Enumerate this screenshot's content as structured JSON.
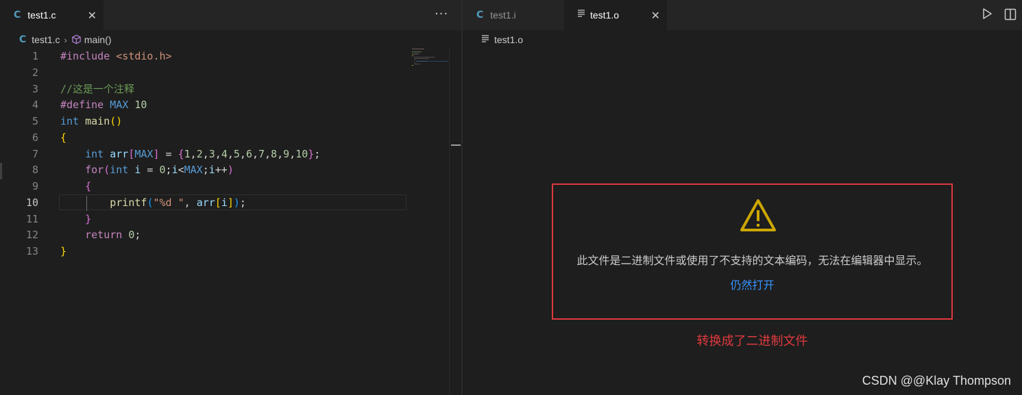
{
  "left": {
    "tab": {
      "icon": "C",
      "label": "test1.c",
      "close": "✕"
    },
    "more_button": "···",
    "breadcrumb": {
      "file_icon": "C",
      "file": "test1.c",
      "sep": "›",
      "symbol": "main()"
    },
    "line_numbers": [
      "1",
      "2",
      "3",
      "4",
      "5",
      "6",
      "7",
      "8",
      "9",
      "10",
      "11",
      "12",
      "13"
    ],
    "current_line": "10"
  },
  "right": {
    "tabs": [
      {
        "icon": "C",
        "label": "test1.i"
      },
      {
        "icon": "file-lines-icon",
        "label": "test1.o",
        "close": "✕"
      }
    ],
    "breadcrumb": {
      "file": "test1.o"
    },
    "warning": {
      "message": "此文件是二进制文件或使用了不支持的文本编码，无法在编辑器中显示。",
      "link": "仍然打开"
    },
    "annotation": "转换成了二进制文件"
  },
  "watermark": "CSDN @@Klay Thompson",
  "colors": {
    "accent_link": "#3794ff",
    "highlight_border": "#e0393e",
    "warning_icon": "#cca700"
  }
}
